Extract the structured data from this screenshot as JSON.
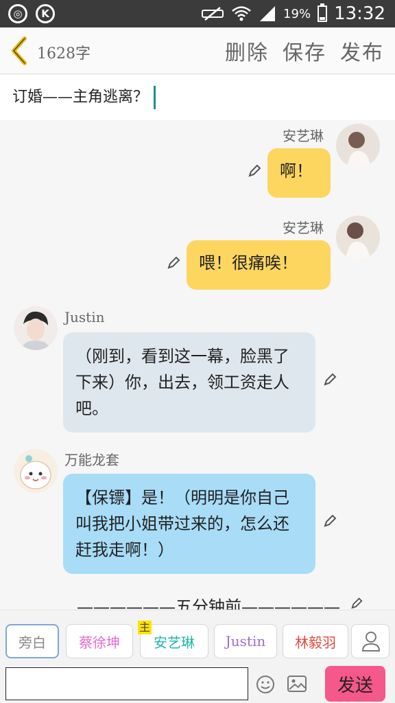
{
  "status_bar": {
    "left_icons": [
      "weibo-icon",
      "k-app-icon"
    ],
    "battery_pct": "19%",
    "time": "13:32",
    "battery_level": 0.19
  },
  "header": {
    "word_count": "1628字",
    "delete_label": "删除",
    "save_label": "保存",
    "publish_label": "发布"
  },
  "title": {
    "value": "订婚——主角逃离？"
  },
  "messages": [
    {
      "speaker": "安艺琳",
      "text": "啊！"
    },
    {
      "speaker": "安艺琳",
      "text": "喂！很痛唉！"
    },
    {
      "speaker": "Justin",
      "text": "（刚到，看到这一幕，脸黑了下来）你，出去，领工资走人吧。"
    },
    {
      "speaker": "万能龙套",
      "text": "【保镖】是！（明明是你自己叫我把小姐带过来的，怎么还赶我走啊！）"
    }
  ],
  "divider": {
    "text": "——————五分钟前——————"
  },
  "characters": {
    "tabs": [
      {
        "label": "旁白",
        "color": "#888888"
      },
      {
        "label": "蔡徐坤",
        "color": "#e46ad6"
      },
      {
        "label": "安艺琳",
        "color": "#22b6aa"
      },
      {
        "label": "Justin",
        "color": "#a26ad0"
      },
      {
        "label": "林毅羽",
        "color": "#e5473e"
      }
    ],
    "main_tag": "主"
  },
  "composer": {
    "placeholder": "",
    "send_label": "发送"
  },
  "colors": {
    "yellow_bubble": "#fdd660",
    "grey_bubble": "#dfe7ee",
    "blue_bubble": "#a8dcf7",
    "send_button": "#f5588a",
    "caret": "#1a8f86"
  }
}
